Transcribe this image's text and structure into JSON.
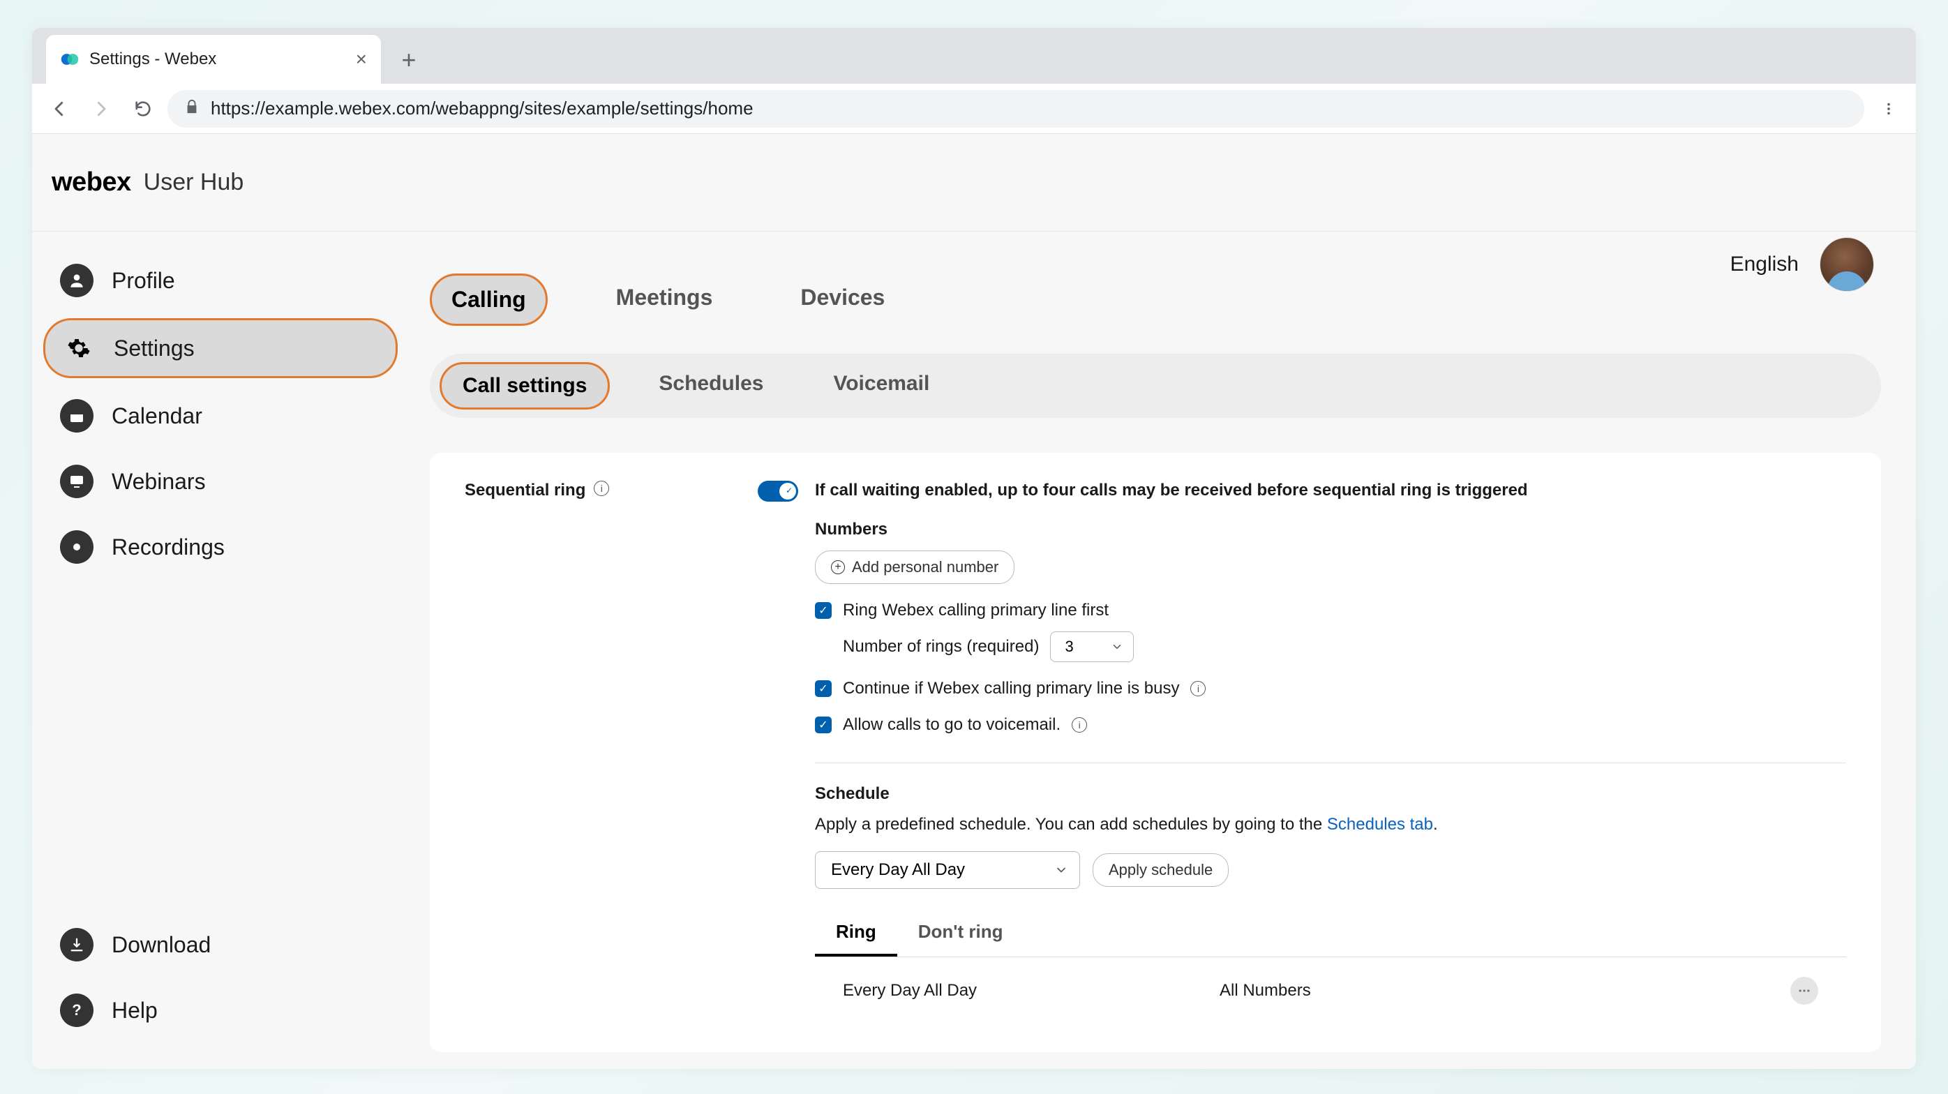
{
  "browser": {
    "tab_title": "Settings - Webex",
    "url": "https://example.webex.com/webappng/sites/example/settings/home"
  },
  "header": {
    "wordmark": "webex",
    "sub": "User Hub"
  },
  "topright": {
    "language": "English"
  },
  "sidebar": {
    "items": [
      {
        "label": "Profile"
      },
      {
        "label": "Settings"
      },
      {
        "label": "Calendar"
      },
      {
        "label": "Webinars"
      },
      {
        "label": "Recordings"
      }
    ],
    "footer": [
      {
        "label": "Download"
      },
      {
        "label": "Help"
      }
    ]
  },
  "tabs": {
    "main": [
      "Calling",
      "Meetings",
      "Devices"
    ],
    "sub": [
      "Call settings",
      "Schedules",
      "Voicemail"
    ]
  },
  "panel": {
    "title": "Sequential ring",
    "note": "If call waiting enabled, up to four calls may be received before sequential ring is triggered",
    "numbers_label": "Numbers",
    "add_btn": "Add personal number",
    "chk1": "Ring Webex calling primary line first",
    "rings_label": "Number of rings (required)",
    "rings_value": "3",
    "chk2": "Continue if Webex calling primary line is busy",
    "chk3": "Allow calls to go to voicemail.",
    "schedule_label": "Schedule",
    "schedule_desc_pre": "Apply a predefined schedule. You can add schedules by going to the ",
    "schedule_link": "Schedules tab",
    "schedule_desc_post": ".",
    "schedule_select": "Every Day All Day",
    "apply_btn": "Apply schedule",
    "ring_tabs": [
      "Ring",
      "Don't ring"
    ],
    "ring_rows": [
      {
        "name": "Every Day All Day",
        "scope": "All Numbers"
      }
    ]
  }
}
